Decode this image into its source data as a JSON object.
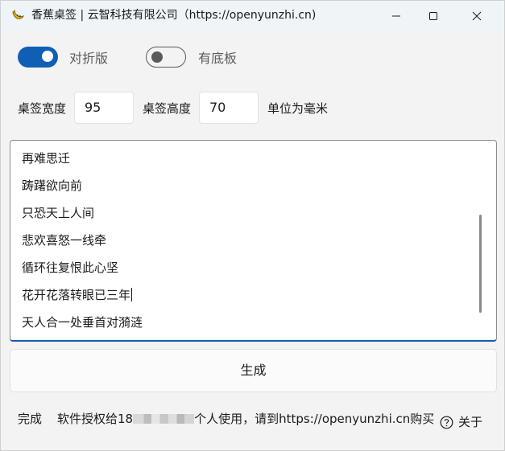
{
  "window": {
    "title": "香蕉桌签 | 云智科技有限公司（https://openyunzhi.cn)"
  },
  "toggles": {
    "fold_label": "对折版",
    "fold_on": true,
    "base_label": "有底板",
    "base_on": false
  },
  "size": {
    "width_label": "桌签宽度",
    "width_value": "95",
    "height_label": "桌签高度",
    "height_value": "70",
    "unit_label": "单位为毫米"
  },
  "editor": {
    "lines": [
      "再难思迁",
      "踌躇欲向前",
      "只恐天上人间",
      "悲欢喜怒一线牵",
      "循环往复恨此心坚",
      "花开花落转眼已三年",
      "天人合一处垂首对漪涟"
    ]
  },
  "generate_button": "生成",
  "status": {
    "state": "完成",
    "license_prefix": "软件授权给18",
    "license_suffix": "个人使用，请到https://openyunzhi.cn购买",
    "about_label": "关于"
  },
  "colors": {
    "accent": "#0f5fb4",
    "window_bg": "#f3f3f3",
    "titlebar_bg": "#eff4f9"
  }
}
